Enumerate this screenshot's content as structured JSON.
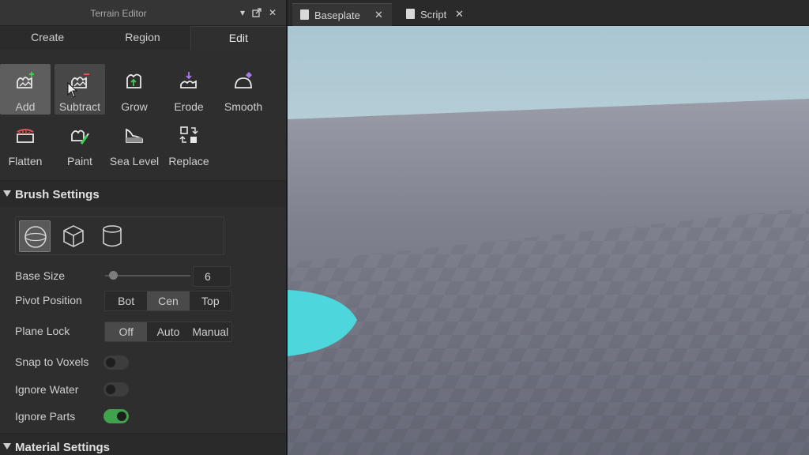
{
  "panel": {
    "title": "Terrain Editor",
    "header_buttons": [
      "chevron-down-icon",
      "undock-icon",
      "close-icon"
    ],
    "mode_tabs": [
      {
        "label": "Create",
        "active": false
      },
      {
        "label": "Region",
        "active": false
      },
      {
        "label": "Edit",
        "active": true
      }
    ],
    "tools": [
      {
        "label": "Add",
        "icon": "terrain-add-icon",
        "state": "selected"
      },
      {
        "label": "Subtract",
        "icon": "terrain-subtract-icon",
        "state": "hover"
      },
      {
        "label": "Grow",
        "icon": "terrain-grow-icon",
        "state": ""
      },
      {
        "label": "Erode",
        "icon": "terrain-erode-icon",
        "state": ""
      },
      {
        "label": "Smooth",
        "icon": "terrain-smooth-icon",
        "state": ""
      },
      {
        "label": "Flatten",
        "icon": "terrain-flatten-icon",
        "state": ""
      },
      {
        "label": "Paint",
        "icon": "terrain-paint-icon",
        "state": ""
      },
      {
        "label": "Sea Level",
        "icon": "sea-level-icon",
        "state": ""
      },
      {
        "label": "Replace",
        "icon": "replace-icon",
        "state": ""
      }
    ],
    "brush_settings": {
      "header": "Brush Settings",
      "shapes": [
        {
          "icon": "sphere-shape-icon",
          "selected": true
        },
        {
          "icon": "cube-shape-icon",
          "selected": false
        },
        {
          "icon": "cylinder-shape-icon",
          "selected": false
        }
      ],
      "base_size": {
        "label": "Base Size",
        "value": "6",
        "slider_fraction": 0.05
      },
      "pivot_position": {
        "label": "Pivot Position",
        "options": [
          "Bot",
          "Cen",
          "Top"
        ],
        "selected": "Cen"
      },
      "plane_lock": {
        "label": "Plane Lock",
        "options": [
          "Off",
          "Auto",
          "Manual"
        ],
        "selected": "Off"
      },
      "snap_to_voxels": {
        "label": "Snap to Voxels",
        "on": false
      },
      "ignore_water": {
        "label": "Ignore Water",
        "on": false
      },
      "ignore_parts": {
        "label": "Ignore Parts",
        "on": true
      }
    },
    "material_settings": {
      "header": "Material Settings"
    }
  },
  "doc_tabs": [
    {
      "label": "Baseplate",
      "icon": "place-file-icon",
      "active": true
    },
    {
      "label": "Script",
      "icon": "script-file-icon",
      "active": false
    }
  ],
  "colors": {
    "accent_toggle": "#3fa34d",
    "brush_preview": "#4dd6dc",
    "sky_top": "#a9c6d1",
    "ground": "#6f7280"
  }
}
